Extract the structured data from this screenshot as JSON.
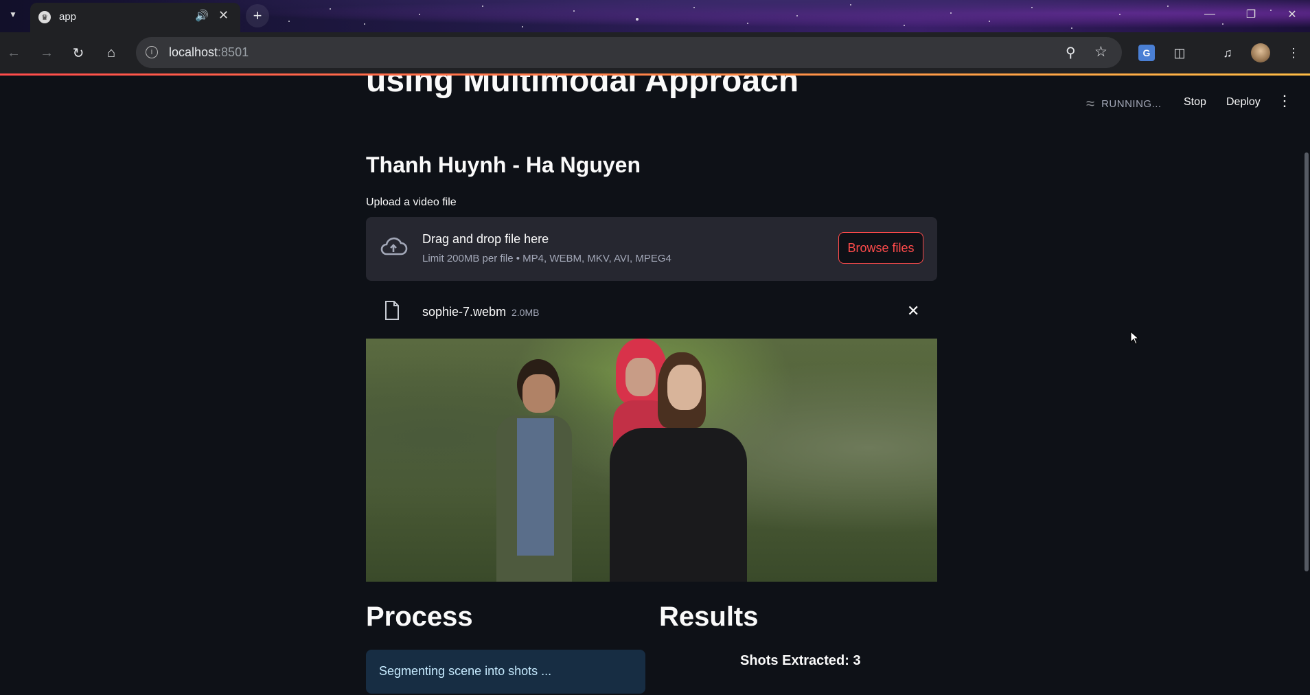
{
  "browser": {
    "tab_title": "app",
    "new_tab_symbol": "+",
    "address": {
      "host": "localhost",
      "port": ":8501"
    }
  },
  "app": {
    "status_text": "RUNNING...",
    "stop_label": "Stop",
    "deploy_label": "Deploy",
    "title_partial": "using Multimodal Approach",
    "authors": "Thanh Huynh - Ha Nguyen",
    "uploader": {
      "label": "Upload a video file",
      "drop_title": "Drag and drop file here",
      "limit_text": "Limit 200MB per file • MP4, WEBM, MKV, AVI, MPEG4",
      "browse_label": "Browse files"
    },
    "uploaded_file": {
      "name": "sophie-7.webm",
      "size": "2.0MB"
    },
    "process": {
      "heading": "Process",
      "status_message": "Segmenting scene into shots ..."
    },
    "results": {
      "heading": "Results",
      "shots_text": "Shots Extracted: 3"
    }
  },
  "colors": {
    "accent": "#ff4b4b",
    "background": "#0e1117",
    "dropzone": "#262730",
    "info_bg": "#172d43",
    "info_text": "#c7ebff"
  },
  "icons": [
    "chevron-down-icon",
    "app-favicon",
    "speaker-icon",
    "close-icon",
    "back-icon",
    "forward-icon",
    "reload-icon",
    "home-icon",
    "site-info-icon",
    "zoom-icon",
    "bookmark-star-icon",
    "translate-icon",
    "extensions-icon",
    "media-control-icon",
    "profile-avatar",
    "chrome-menu-icon",
    "minimize-icon",
    "restore-icon",
    "window-close-icon",
    "running-icon",
    "more-menu-icon",
    "upload-cloud-icon",
    "file-icon",
    "remove-file-icon"
  ]
}
